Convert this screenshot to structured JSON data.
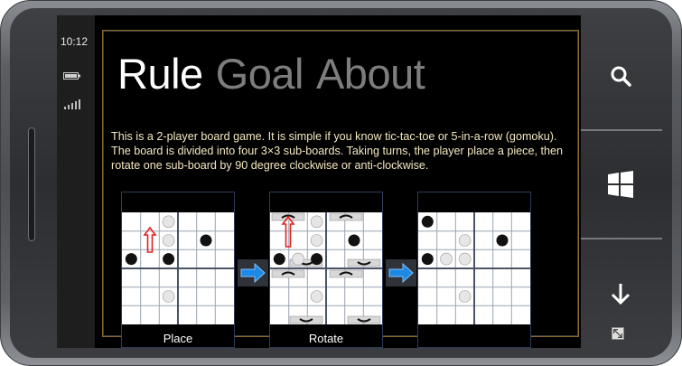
{
  "status": {
    "time": "10:12"
  },
  "pivot": {
    "items": [
      {
        "label": "Rule",
        "active": true
      },
      {
        "label": "Goal",
        "active": false
      },
      {
        "label": "About",
        "active": false
      }
    ]
  },
  "rule": {
    "description": "This is a 2-player board game. It is simple if you know tic-tac-toe or 5-in-a-row (gomoku). The board is divided into four 3×3 sub-boards. Taking turns, the player place a piece, then rotate one sub-board by 90 degree clockwise or anti-clockwise.",
    "panels": [
      {
        "caption": "Place"
      },
      {
        "caption": "Rotate"
      },
      {
        "caption": ""
      }
    ]
  },
  "icons": {
    "battery": "battery-icon",
    "signal": "signal-icon",
    "search": "search-icon",
    "start": "windows-logo-icon",
    "back": "back-arrow-icon",
    "arrow": "right-arrow-icon",
    "resize": "resize-icon"
  },
  "colors": {
    "description_text": "#f5e8c0",
    "pivot_active": "#ffffff",
    "pivot_inactive": "#7d7d7d",
    "arrow_blue": "#1e88e5",
    "place_marker": "#e02020"
  }
}
